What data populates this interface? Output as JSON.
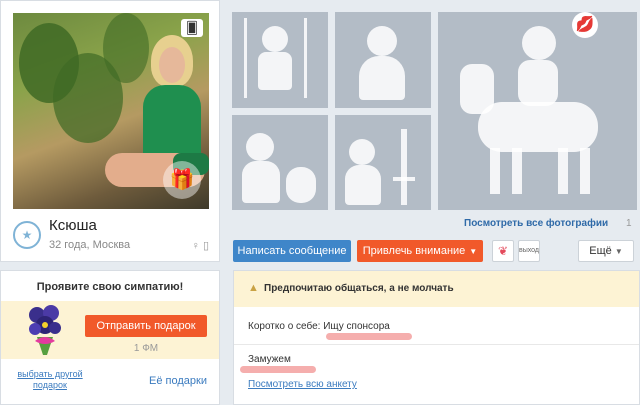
{
  "profile": {
    "name": "Ксюша",
    "meta": "32 года, Москва",
    "status_icon": "star-icon",
    "device_icons": "♀ ▯"
  },
  "sympathy": {
    "title": "Проявите свою симпатию!",
    "send_gift_label": "Отправить подарок",
    "price": "1 ФМ",
    "choose_other_gift": "выбрать другой подарок",
    "my_gifts": "Её подарки"
  },
  "photos": {
    "all_photos_label": "Посмотреть все фотографии",
    "count": "1"
  },
  "actions": {
    "write_message": "Написать сообщение",
    "attract_attention": "Привлечь внимание",
    "exit_label": "выход",
    "more": "Ещё"
  },
  "about": {
    "preference": "Предпочитаю общаться, а не молчать",
    "about_self": "Коротко о себе: Ищу спонсора",
    "marital": "Замужем",
    "full_profile": "Посмотреть всю анкету"
  },
  "colors": {
    "primary": "#3f86c9",
    "accent": "#f1592a",
    "highlight_bg": "#fdf3d4",
    "placeholder": "#b3bcc6"
  }
}
